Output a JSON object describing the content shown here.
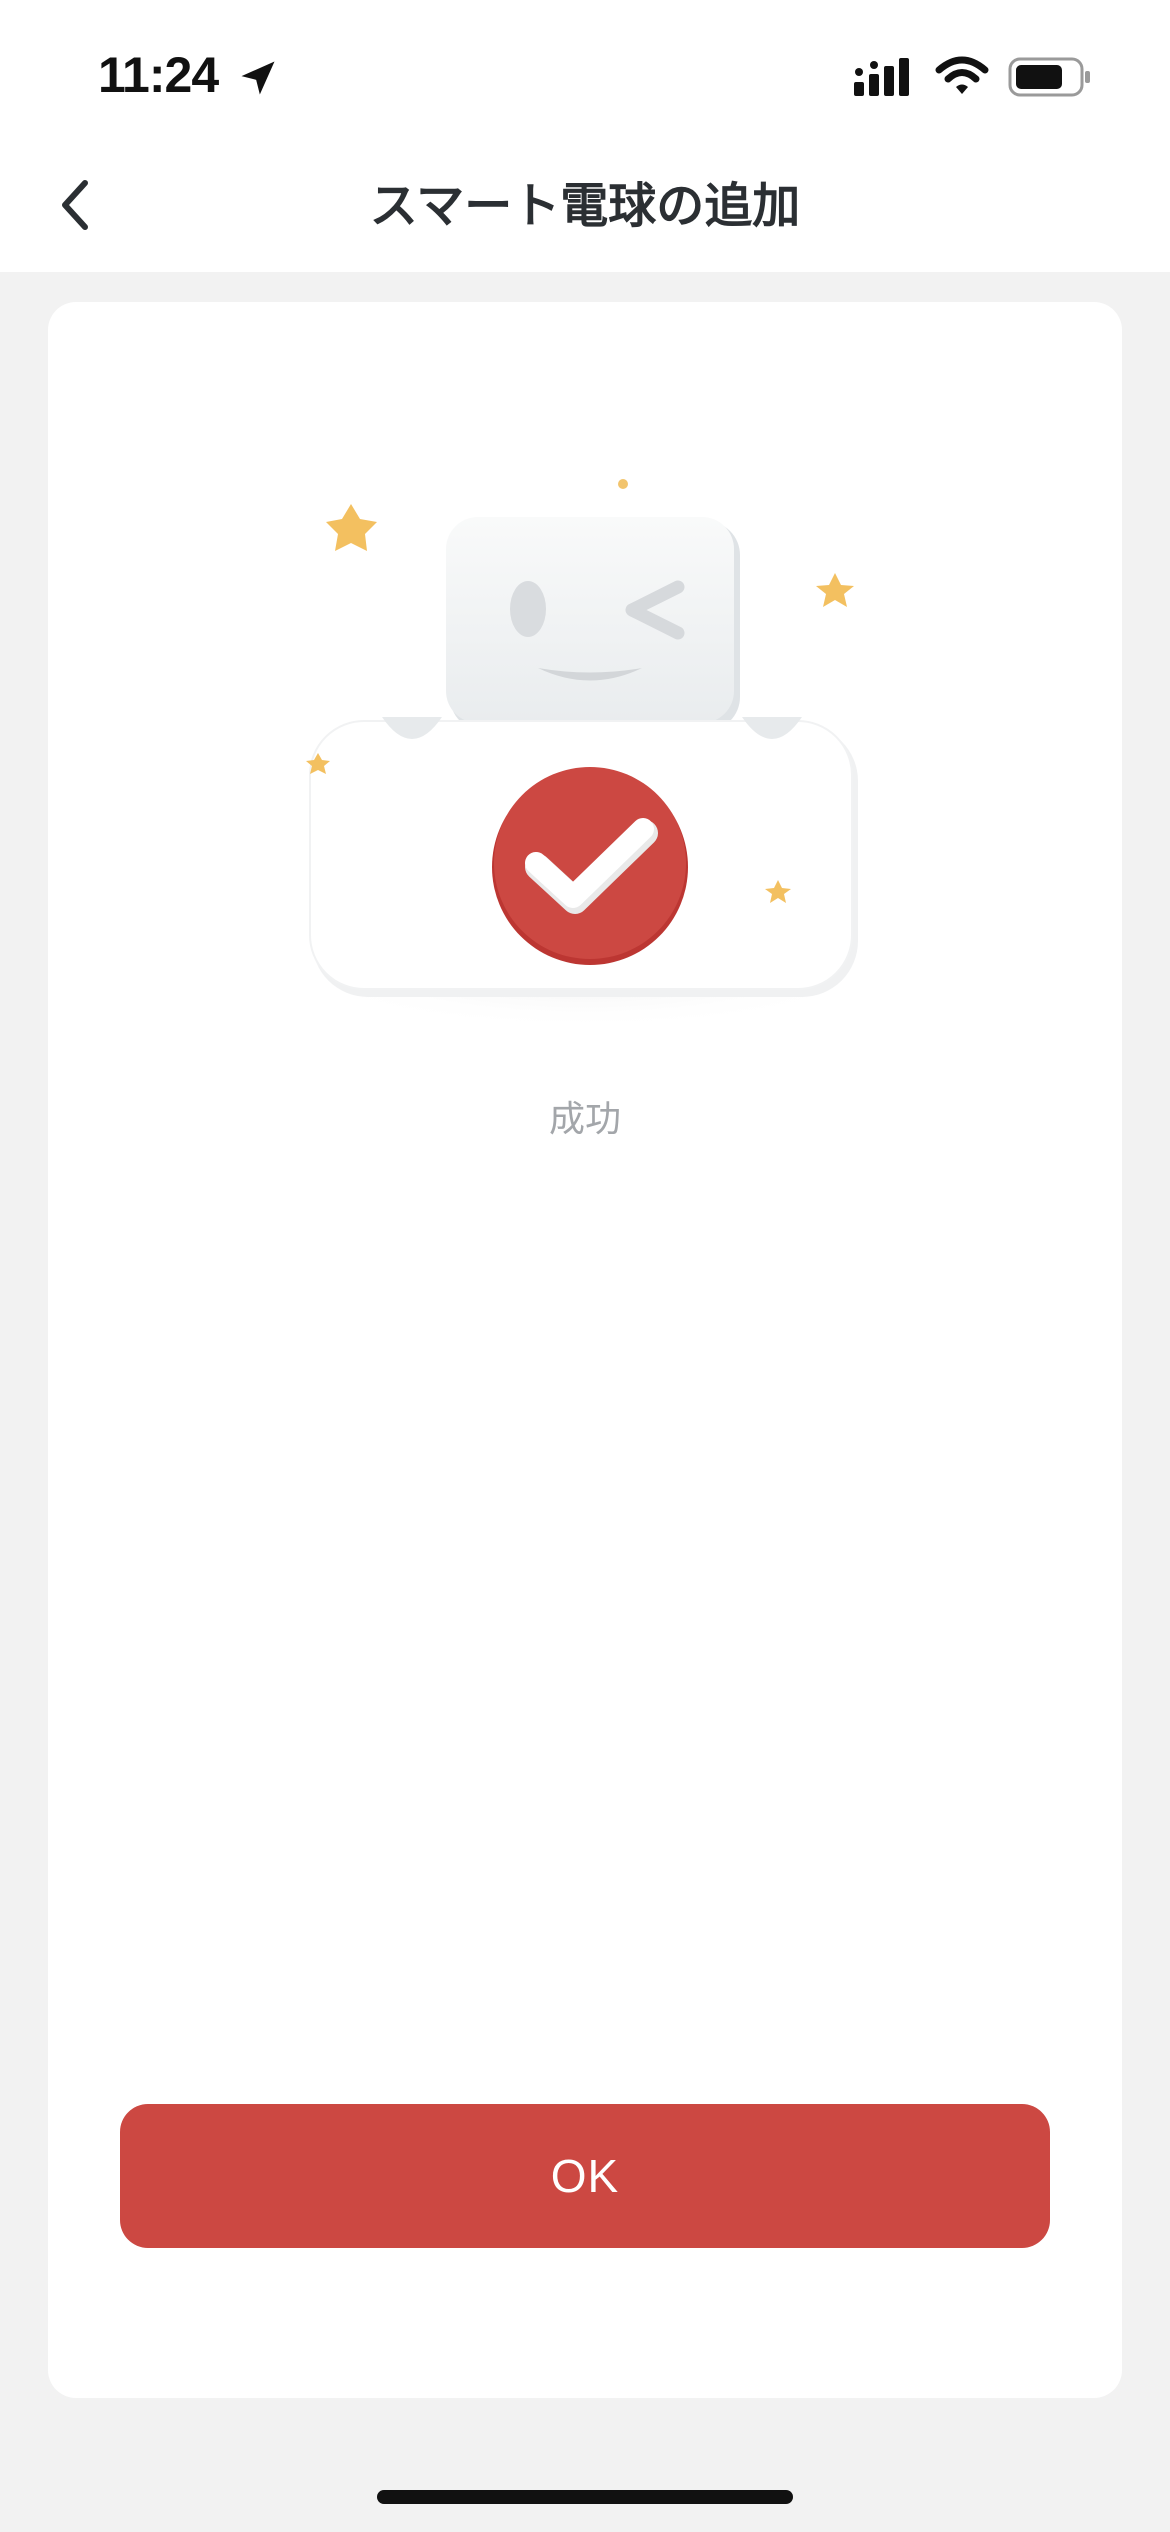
{
  "status_bar": {
    "time": "11:24",
    "icons": [
      "location-arrow-icon",
      "cellular-signal-icon",
      "wifi-icon",
      "battery-icon"
    ]
  },
  "nav": {
    "title": "スマート電球の追加",
    "back_icon": "chevron-left-icon"
  },
  "result": {
    "illustration": "robot-with-checkmark-illustration",
    "status_text": "成功"
  },
  "actions": {
    "ok_label": "OK"
  },
  "colors": {
    "accent": "#cc4842",
    "background": "#f2f2f2",
    "card": "#ffffff",
    "title_text": "#2b2f33",
    "secondary_text": "#a3a6aa",
    "star": "#f2c46d"
  }
}
